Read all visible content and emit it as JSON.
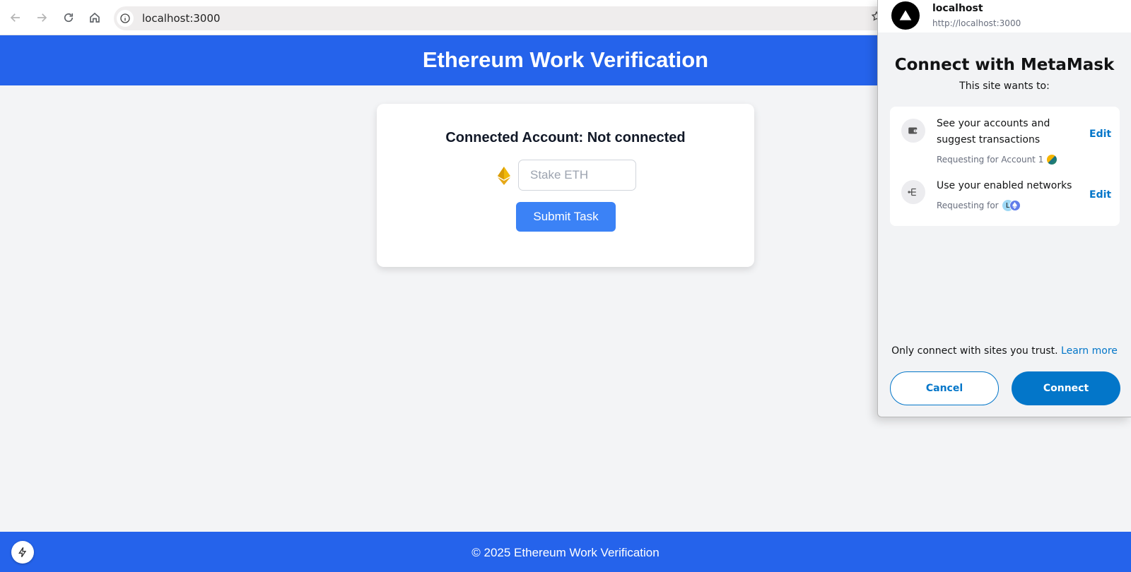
{
  "browser": {
    "url": "localhost:3000"
  },
  "app": {
    "title": "Ethereum Work Verification",
    "account_label": "Connected Account: Not connected",
    "stake_placeholder": "Stake ETH",
    "submit_label": "Submit Task",
    "footer": "© 2025 Ethereum Work Verification"
  },
  "metamask": {
    "site_name": "localhost",
    "site_url": "http://localhost:3000",
    "title": "Connect with MetaMask",
    "subtitle": "This site wants to:",
    "permissions": [
      {
        "title": "See your accounts and suggest transactions",
        "subtitle": "Requesting for Account 1",
        "edit_label": "Edit",
        "icon": "wallet-icon"
      },
      {
        "title": "Use your enabled networks",
        "subtitle": "Requesting for",
        "edit_label": "Edit",
        "icon": "network-icon",
        "network_badge_letter": "L"
      }
    ],
    "trust_text": "Only connect with sites you trust.",
    "learn_more": "Learn more",
    "cancel_label": "Cancel",
    "connect_label": "Connect"
  },
  "colors": {
    "header_blue": "#2563eb",
    "submit_blue": "#3b82f6",
    "metamask_blue": "#0376c9",
    "eth_gold": "#e6a817"
  }
}
